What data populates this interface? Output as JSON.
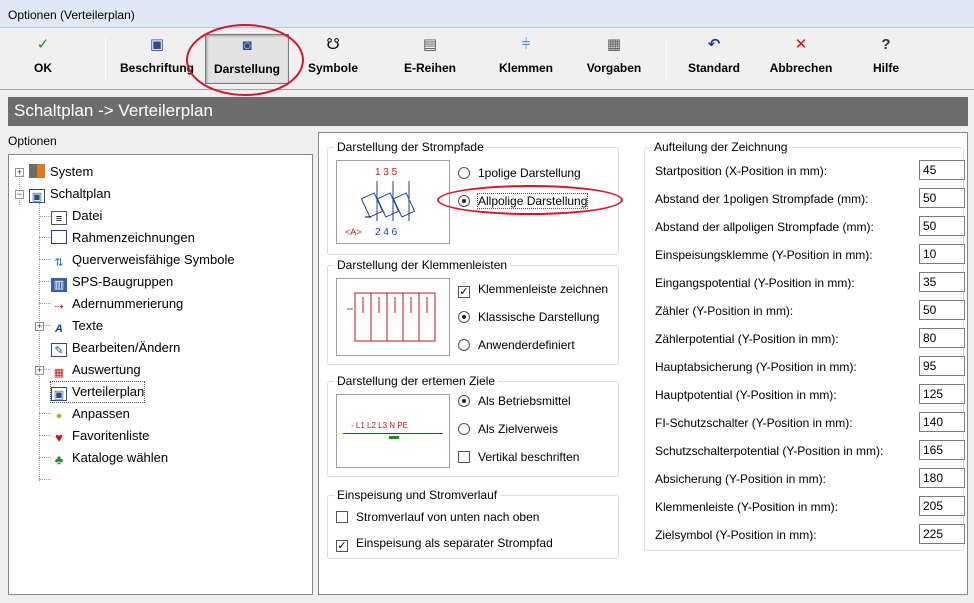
{
  "window": {
    "title": "Optionen (Verteilerplan)"
  },
  "toolbar": {
    "buttons": [
      {
        "label": "OK",
        "icon": "check-icon"
      },
      {
        "label": "Beschriftung",
        "icon": "label-icon"
      },
      {
        "label": "Darstellung",
        "icon": "display-icon",
        "pressed": true
      },
      {
        "label": "Symbole",
        "icon": "symbol-icon"
      },
      {
        "label": "E-Reihen",
        "icon": "series-icon"
      },
      {
        "label": "Klemmen",
        "icon": "terminal-icon"
      },
      {
        "label": "Vorgaben",
        "icon": "defaults-icon"
      },
      {
        "label": "Standard",
        "icon": "undo-icon"
      },
      {
        "label": "Abbrechen",
        "icon": "cancel-icon"
      },
      {
        "label": "Hilfe",
        "icon": "help-icon"
      }
    ]
  },
  "header": {
    "title": "Schaltplan -> Verteilerplan"
  },
  "tree": {
    "title": "Optionen",
    "items": [
      {
        "label": "System"
      },
      {
        "label": "Schaltplan"
      },
      {
        "label": "Datei"
      },
      {
        "label": "Rahmenzeichnungen"
      },
      {
        "label": "Querverweisfähige Symbole"
      },
      {
        "label": "SPS-Baugruppen"
      },
      {
        "label": "Adernummerierung"
      },
      {
        "label": "Texte"
      },
      {
        "label": "Bearbeiten/Ändern"
      },
      {
        "label": "Auswertung"
      },
      {
        "label": "Verteilerplan"
      },
      {
        "label": "Anpassen"
      },
      {
        "label": "Favoritenliste"
      },
      {
        "label": "Kataloge wählen"
      }
    ]
  },
  "strompfade": {
    "title": "Darstellung der Strompfade",
    "option1": "1polige Darstellung",
    "option2": "Allpolige Darstellung",
    "preview_top": "1  3  5",
    "preview_bottom": "2  4  6",
    "preview_tag": "<A>"
  },
  "klemmenleisten": {
    "title": "Darstellung der Klemmenleisten",
    "check": "Klemmenleiste zeichnen",
    "option1": "Klassische Darstellung",
    "option2": "Anwenderdefiniert"
  },
  "ziele": {
    "title": "Darstellung der ertemen Ziele",
    "option1": "Als Betriebsmittel",
    "option2": "Als Zielverweis",
    "check": "Vertikal beschriften",
    "preview_text": "- L1 L2 L3 N PE"
  },
  "einspeisung": {
    "title": "Einspeisung und Stromverlauf",
    "check1": "Stromverlauf von unten nach oben",
    "check2": "Einspeisung als separater Strompfad"
  },
  "aufteilung": {
    "title": "Aufteilung der Zeichnung",
    "fields": [
      {
        "label": "Startposition (X-Position in mm):",
        "value": "45"
      },
      {
        "label": "Abstand der 1poligen Strompfade (mm):",
        "value": "50"
      },
      {
        "label": "Abstand der allpoligen Strompfade (mm):",
        "value": "50"
      },
      {
        "label": "Einspeisungsklemme (Y-Position in mm):",
        "value": "10"
      },
      {
        "label": "Eingangspotential (Y-Position in mm):",
        "value": "35"
      },
      {
        "label": "Zähler (Y-Position in mm):",
        "value": "50"
      },
      {
        "label": "Zählerpotential (Y-Position in mm):",
        "value": "80"
      },
      {
        "label": "Hauptabsicherung (Y-Position in mm):",
        "value": "95"
      },
      {
        "label": "Hauptpotential (Y-Position in mm):",
        "value": "125"
      },
      {
        "label": "FI-Schutzschalter (Y-Position in mm):",
        "value": "140"
      },
      {
        "label": "Schutzschalterpotential (Y-Position in mm):",
        "value": "165"
      },
      {
        "label": "Absicherung (Y-Position in mm):",
        "value": "180"
      },
      {
        "label": "Klemmenleiste (Y-Position in mm):",
        "value": "205"
      },
      {
        "label": "Zielsymbol (Y-Position in mm):",
        "value": "225"
      }
    ]
  }
}
